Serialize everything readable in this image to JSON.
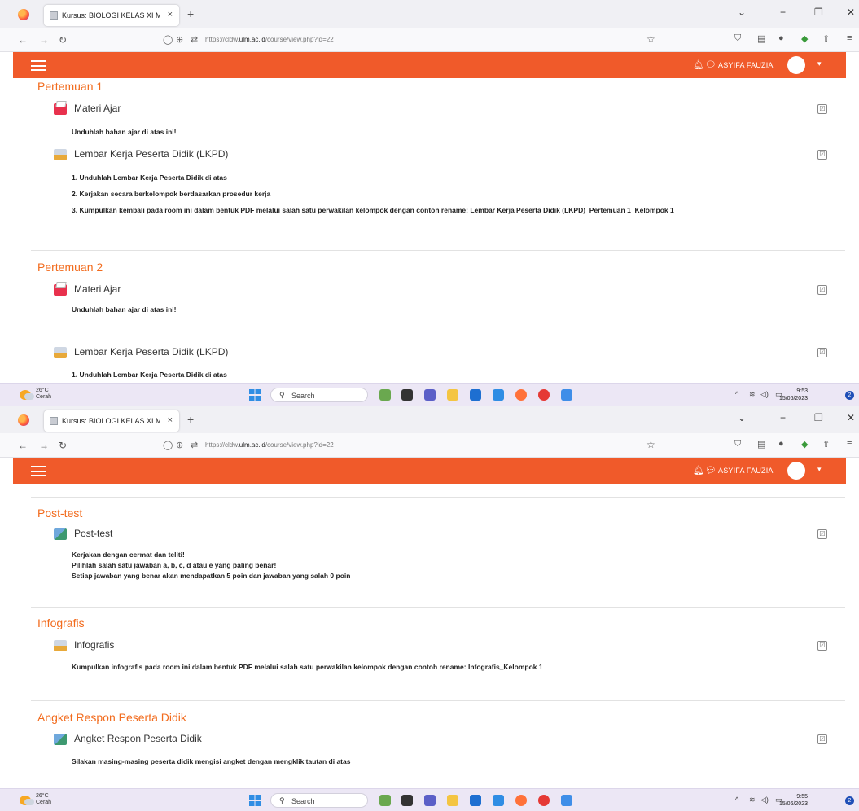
{
  "browser": {
    "tab_title": "Kursus: BIOLOGI KELAS XI MIPA",
    "tab_close": "×",
    "new_tab": "+",
    "url_prefix": "https://cldw.",
    "url_domain": "ulm.ac.id",
    "url_path": "/course/view.php?id=22"
  },
  "header": {
    "user_name": "ASYIFA FAUZIA"
  },
  "screen1": {
    "sections": [
      {
        "title": "Pertemuan 1",
        "activities": [
          {
            "label": "Materi Ajar",
            "desc": "Unduhlah bahan ajar di atas ini!"
          },
          {
            "label": "Lembar Kerja Peserta Didik (LKPD)",
            "desc": [
              "1. Unduhlah Lembar Kerja Peserta Didik di atas",
              "2. Kerjakan secara berkelompok berdasarkan prosedur kerja",
              "3. Kumpulkan kembali pada room ini dalam bentuk PDF melalui salah satu perwakilan kelompok dengan contoh rename: Lembar Kerja Peserta Didik (LKPD)_Pertemuan 1_Kelompok 1"
            ]
          }
        ]
      },
      {
        "title": "Pertemuan 2",
        "activities": [
          {
            "label": "Materi Ajar",
            "desc": "Unduhlah bahan ajar di atas ini!"
          },
          {
            "label": "Lembar Kerja Peserta Didik (LKPD)",
            "desc": "1. Unduhlah Lembar Kerja Peserta Didik di atas"
          }
        ]
      }
    ],
    "taskbar": {
      "temp": "26°C",
      "weather": "Cerah",
      "search": "Search",
      "time": "9:53",
      "date": "15/06/2023",
      "notif_count": "2"
    }
  },
  "screen2": {
    "sections": [
      {
        "title": "Post-test",
        "activities": [
          {
            "label": "Post-test",
            "desc": [
              "Kerjakan dengan cermat dan teliti!",
              "Pilihlah salah satu jawaban a, b, c, d atau e yang paling benar!",
              "Setiap jawaban yang benar akan mendapatkan 5 poin dan jawaban yang salah 0 poin"
            ]
          }
        ]
      },
      {
        "title": "Infografis",
        "activities": [
          {
            "label": "Infografis",
            "desc": "Kumpulkan infografis pada room ini dalam bentuk PDF melalui salah satu perwakilan kelompok dengan contoh rename: Infografis_Kelompok 1"
          }
        ]
      },
      {
        "title": "Angket Respon Peserta Didik",
        "activities": [
          {
            "label": "Angket Respon Peserta Didik",
            "desc": "Silakan masing-masing peserta didik mengisi angket dengan mengklik tautan di atas"
          }
        ]
      }
    ],
    "taskbar": {
      "temp": "26°C",
      "weather": "Cerah",
      "search": "Search",
      "time": "9:55",
      "date": "15/06/2023",
      "notif_count": "2"
    }
  },
  "icons": {
    "check": "☑",
    "bell": "bell-icon",
    "chat": "chat-icon"
  },
  "colors": {
    "header": "#f05a2a",
    "section_title": "#f26b1d"
  }
}
